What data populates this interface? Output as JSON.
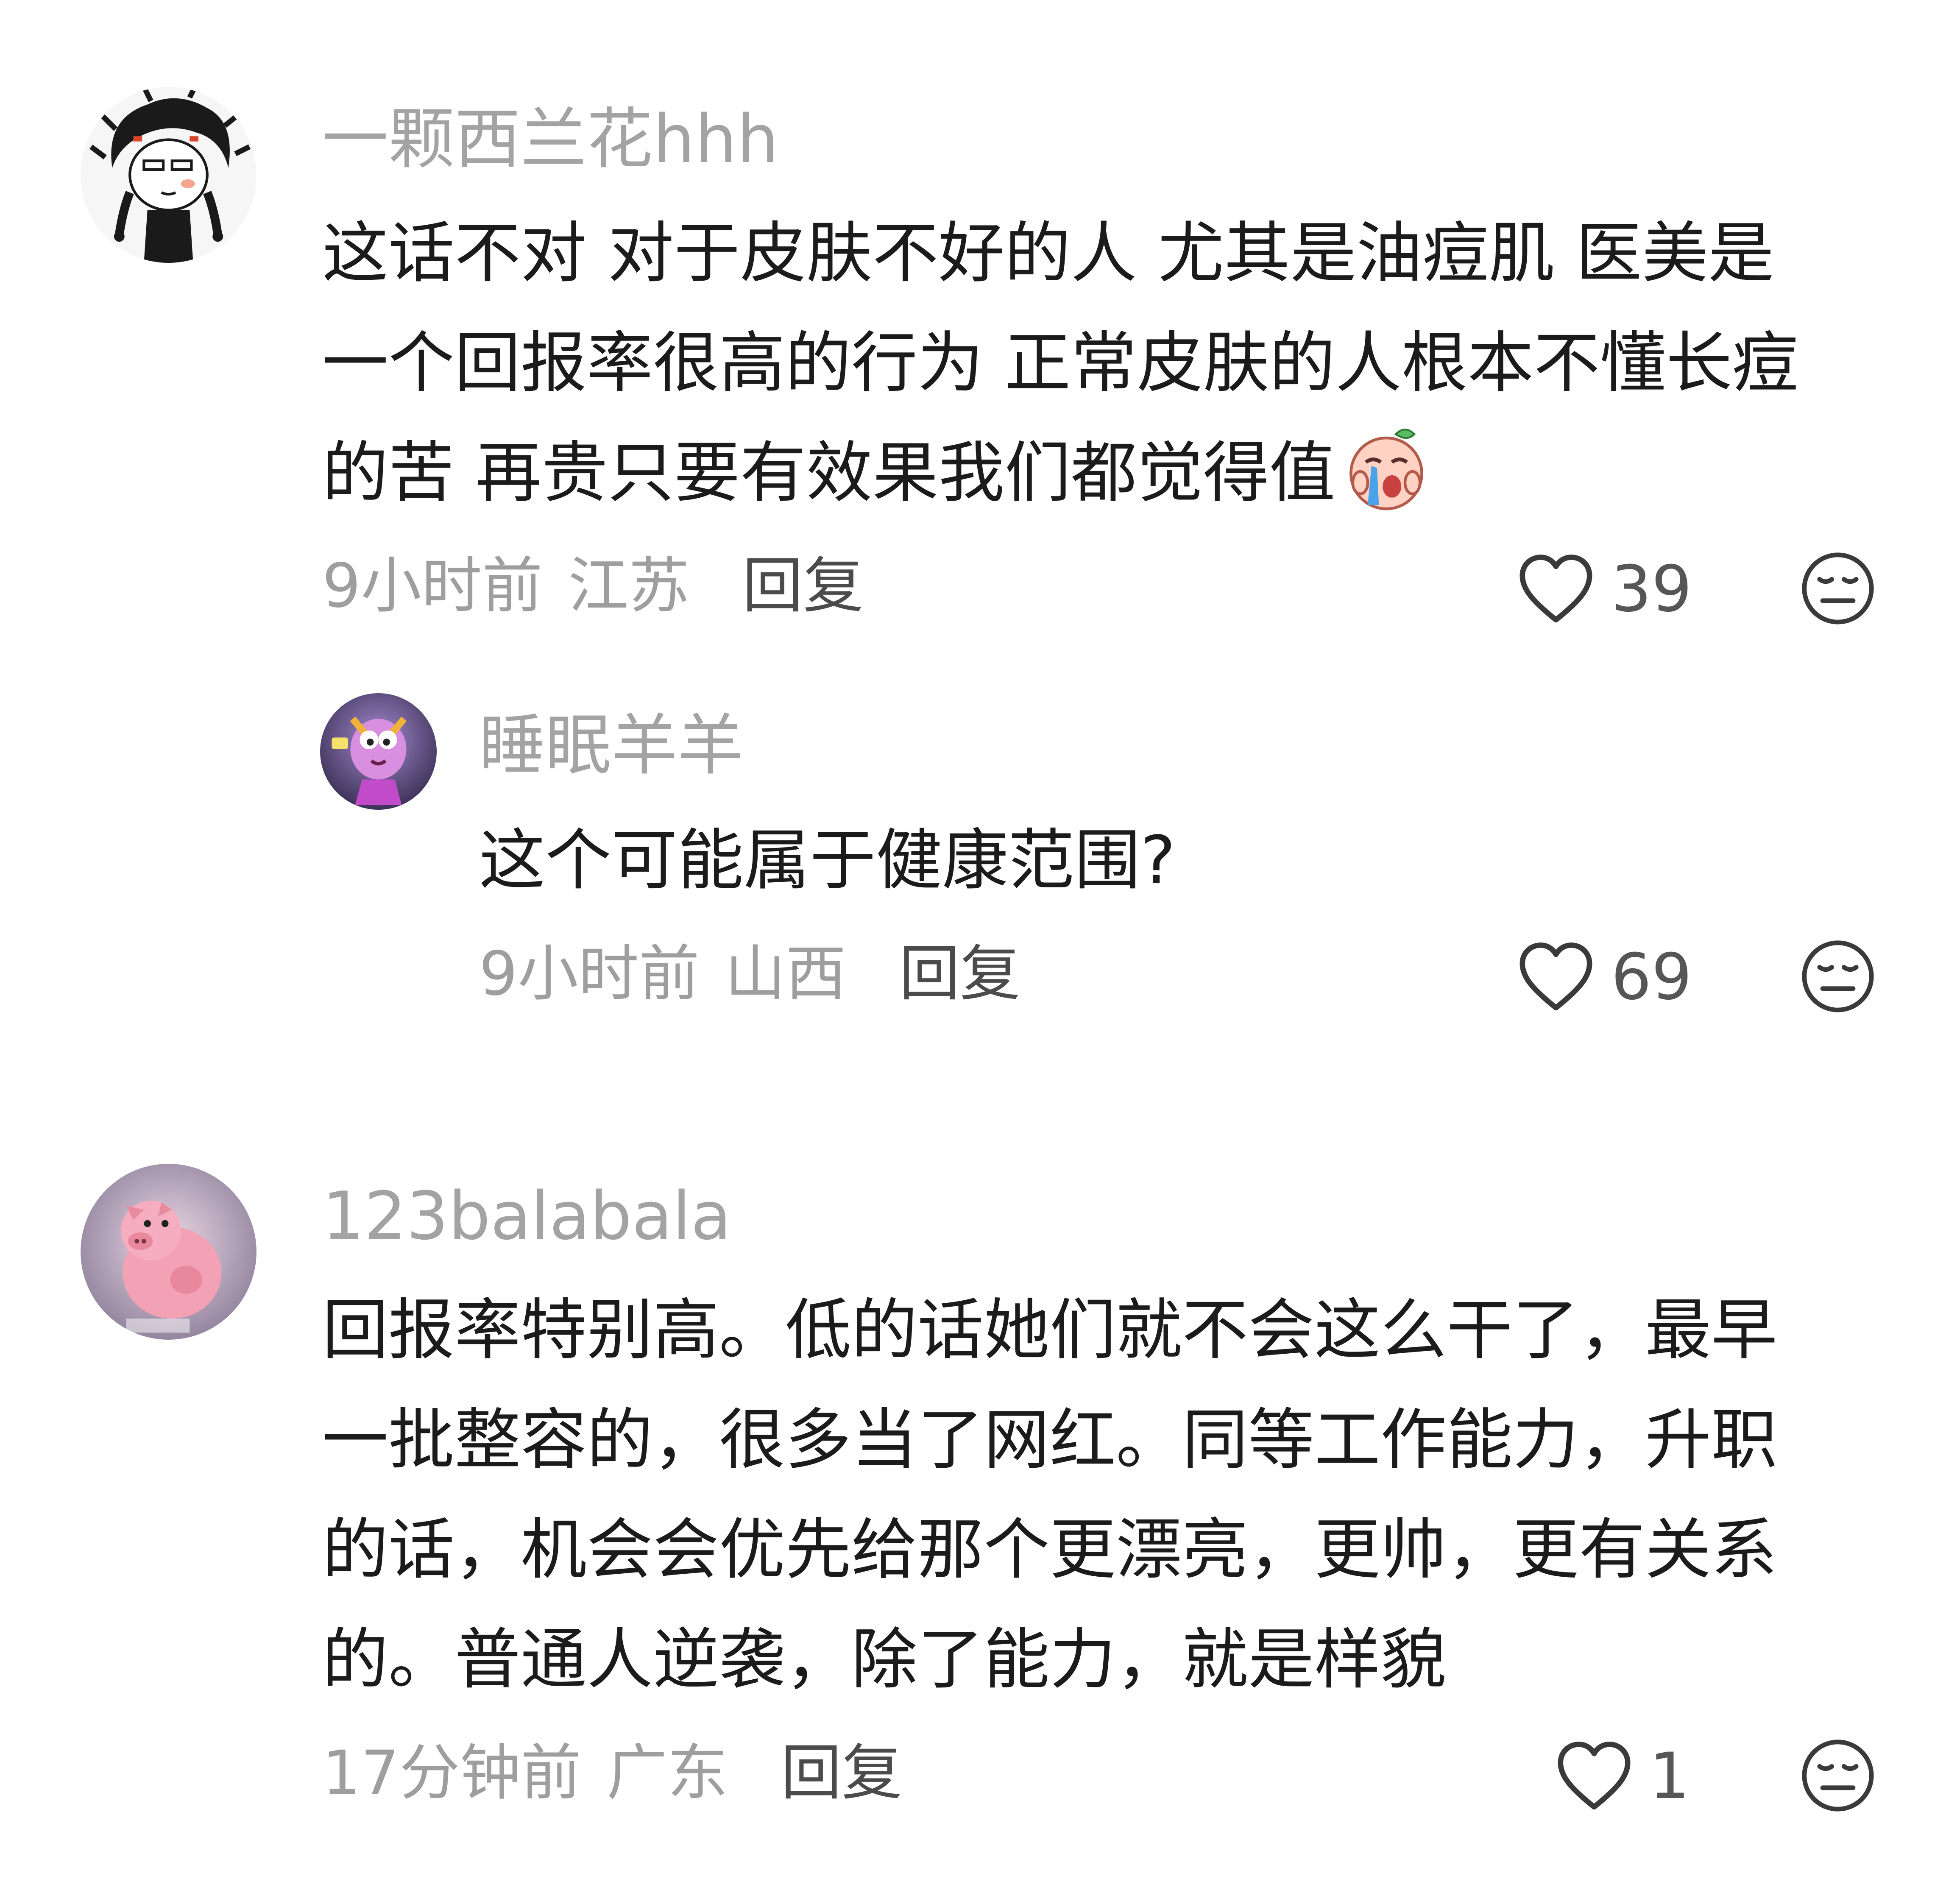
{
  "comments": [
    {
      "username": "一颗西兰花hhh",
      "lines": [
        "这话不对 对于皮肤不好的人 尤其是油痘肌 医美是",
        "一个回报率很高的行为 正常皮肤的人根本不懂长痘",
        "的苦 再贵只要有效果我们都觉得值"
      ],
      "time": "9小时前",
      "region": "江苏",
      "reply_label": "回复",
      "likes": "39",
      "inline_emoji": "crying-emoji"
    },
    {
      "username": "睡眠羊羊",
      "lines": [
        "这个可能属于健康范围?"
      ],
      "time": "9小时前",
      "region": "山西",
      "reply_label": "回复",
      "likes": "69"
    },
    {
      "username": "123balabala",
      "lines": [
        "回报率特别高。低的话她们就不会这么干了，最早",
        "一批整容的，很多当了网红。同等工作能力，升职",
        "的话，机会会优先给那个更漂亮，更帅，更有关系",
        "的。普通人逆袭，除了能力，就是样貌"
      ],
      "time": "17分钟前",
      "region": "广东",
      "reply_label": "回复",
      "likes": "1"
    }
  ],
  "colors": {
    "username": "#a3a3a3",
    "body_text": "#1b1b1b",
    "meta": "#9e9e9e",
    "reply": "#4b4b4b",
    "icon_stroke": "#3a3a3a"
  },
  "icons": [
    "heart-outline-icon",
    "dislike-face-icon",
    "crying-emoji"
  ]
}
